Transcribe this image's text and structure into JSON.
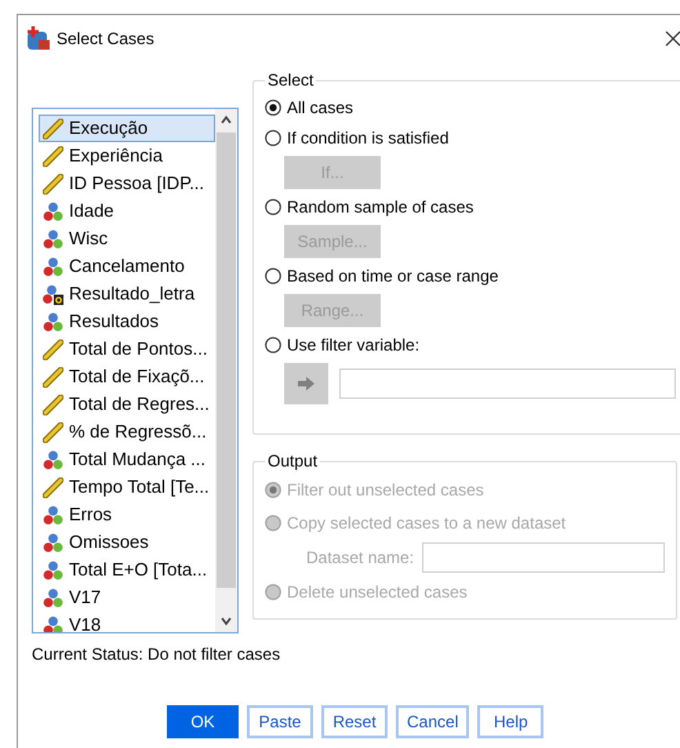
{
  "window": {
    "title": "Select Cases"
  },
  "variables": [
    {
      "label": "Execução",
      "kind": "scale",
      "selected": true
    },
    {
      "label": "Experiência",
      "kind": "scale",
      "selected": false
    },
    {
      "label": "ID Pessoa [IDP...",
      "kind": "scale",
      "selected": false
    },
    {
      "label": "Idade",
      "kind": "nominal",
      "selected": false
    },
    {
      "label": "Wisc",
      "kind": "nominal",
      "selected": false
    },
    {
      "label": "Cancelamento",
      "kind": "nominal",
      "selected": false
    },
    {
      "label": "Resultado_letra",
      "kind": "nominal_string",
      "selected": false
    },
    {
      "label": "Resultados",
      "kind": "nominal",
      "selected": false
    },
    {
      "label": "Total de Pontos...",
      "kind": "scale",
      "selected": false
    },
    {
      "label": "Total de Fixaçõ...",
      "kind": "scale",
      "selected": false
    },
    {
      "label": "Total de Regres...",
      "kind": "scale",
      "selected": false
    },
    {
      "label": "% de Regressõ...",
      "kind": "scale",
      "selected": false
    },
    {
      "label": "Total Mudança ...",
      "kind": "nominal",
      "selected": false
    },
    {
      "label": "Tempo Total [Te...",
      "kind": "scale",
      "selected": false
    },
    {
      "label": "Erros",
      "kind": "nominal",
      "selected": false
    },
    {
      "label": "Omissoes",
      "kind": "nominal",
      "selected": false
    },
    {
      "label": "Total E+O [Tota...",
      "kind": "nominal",
      "selected": false
    },
    {
      "label": "V17",
      "kind": "nominal",
      "selected": false
    },
    {
      "label": "V18",
      "kind": "nominal",
      "selected": false
    }
  ],
  "select": {
    "title": "Select",
    "options": [
      {
        "label": "All cases",
        "selected": true
      },
      {
        "label": "If condition is satisfied",
        "selected": false,
        "button": {
          "label": "If...",
          "disabled": true
        }
      },
      {
        "label": "Random sample of cases",
        "selected": false,
        "button": {
          "label": "Sample...",
          "disabled": true
        }
      },
      {
        "label": "Based on time or case range",
        "selected": false,
        "button": {
          "label": "Range...",
          "disabled": true
        }
      },
      {
        "label": "Use filter variable:",
        "selected": false,
        "filter_field": true
      }
    ]
  },
  "output": {
    "title": "Output",
    "disabled": true,
    "options": [
      {
        "label": "Filter out unselected cases",
        "selected": true
      },
      {
        "label": "Copy selected cases to a new dataset",
        "selected": false,
        "field_label": "Dataset name:"
      },
      {
        "label": "Delete unselected cases",
        "selected": false
      }
    ]
  },
  "status": "Current Status: Do not filter cases",
  "buttons": [
    {
      "label": "OK",
      "default": true
    },
    {
      "label": "Paste",
      "default": false
    },
    {
      "label": "Reset",
      "default": false
    },
    {
      "label": "Cancel",
      "default": false
    },
    {
      "label": "Help",
      "default": false
    }
  ]
}
